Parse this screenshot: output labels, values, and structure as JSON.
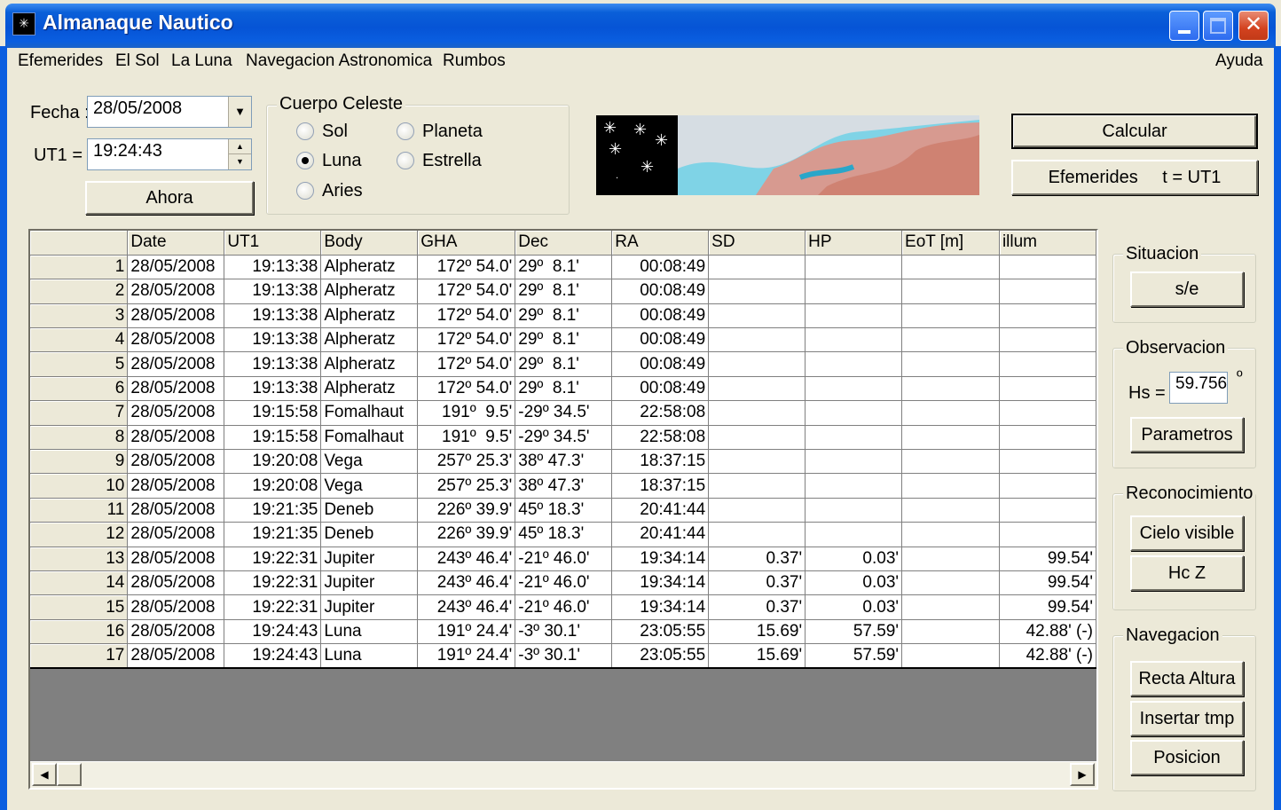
{
  "window": {
    "title": "Almanaque Nautico",
    "icon": "stars-icon"
  },
  "menu": {
    "efemerides": "Efemerides",
    "el_sol": "El Sol",
    "la_luna": "La Luna",
    "navegacion": "Navegacion Astronomica",
    "rumbos": "Rumbos",
    "ayuda": "Ayuda"
  },
  "fecha": {
    "label": "Fecha :",
    "value": "28/05/2008"
  },
  "ut1": {
    "label": "UT1 =",
    "value": "19:24:43"
  },
  "ahora_button": "Ahora",
  "cuerpo_celeste": {
    "title": "Cuerpo Celeste",
    "options": [
      "Sol",
      "Planeta",
      "Luna",
      "Estrella",
      "Aries"
    ],
    "selected": "Luna"
  },
  "calcular_button": "Calcular",
  "efemerides_button": "Efemerides",
  "efemerides_button_suffix": "t = UT1",
  "grid": {
    "columns": [
      "",
      "Date",
      "UT1",
      "Body",
      "GHA",
      "Dec",
      "RA",
      "SD",
      "HP",
      "EoT [m]",
      "illum"
    ],
    "rows": [
      [
        "1",
        "28/05/2008",
        "19:13:38",
        "Alpheratz",
        "172º 54.0'",
        "29º  8.1'",
        "00:08:49",
        "",
        "",
        "",
        ""
      ],
      [
        "2",
        "28/05/2008",
        "19:13:38",
        "Alpheratz",
        "172º 54.0'",
        "29º  8.1'",
        "00:08:49",
        "",
        "",
        "",
        ""
      ],
      [
        "3",
        "28/05/2008",
        "19:13:38",
        "Alpheratz",
        "172º 54.0'",
        "29º  8.1'",
        "00:08:49",
        "",
        "",
        "",
        ""
      ],
      [
        "4",
        "28/05/2008",
        "19:13:38",
        "Alpheratz",
        "172º 54.0'",
        "29º  8.1'",
        "00:08:49",
        "",
        "",
        "",
        ""
      ],
      [
        "5",
        "28/05/2008",
        "19:13:38",
        "Alpheratz",
        "172º 54.0'",
        "29º  8.1'",
        "00:08:49",
        "",
        "",
        "",
        ""
      ],
      [
        "6",
        "28/05/2008",
        "19:13:38",
        "Alpheratz",
        "172º 54.0'",
        "29º  8.1'",
        "00:08:49",
        "",
        "",
        "",
        ""
      ],
      [
        "7",
        "28/05/2008",
        "19:15:58",
        "Fomalhaut",
        "191º  9.5'",
        "-29º 34.5'",
        "22:58:08",
        "",
        "",
        "",
        ""
      ],
      [
        "8",
        "28/05/2008",
        "19:15:58",
        "Fomalhaut",
        "191º  9.5'",
        "-29º 34.5'",
        "22:58:08",
        "",
        "",
        "",
        ""
      ],
      [
        "9",
        "28/05/2008",
        "19:20:08",
        "Vega",
        "257º 25.3'",
        "38º 47.3'",
        "18:37:15",
        "",
        "",
        "",
        ""
      ],
      [
        "10",
        "28/05/2008",
        "19:20:08",
        "Vega",
        "257º 25.3'",
        "38º 47.3'",
        "18:37:15",
        "",
        "",
        "",
        ""
      ],
      [
        "11",
        "28/05/2008",
        "19:21:35",
        "Deneb",
        "226º 39.9'",
        "45º 18.3'",
        "20:41:44",
        "",
        "",
        "",
        ""
      ],
      [
        "12",
        "28/05/2008",
        "19:21:35",
        "Deneb",
        "226º 39.9'",
        "45º 18.3'",
        "20:41:44",
        "",
        "",
        "",
        ""
      ],
      [
        "13",
        "28/05/2008",
        "19:22:31",
        "Jupiter",
        "243º 46.4'",
        "-21º 46.0'",
        "19:34:14",
        "0.37'",
        "0.03'",
        "",
        "99.54'"
      ],
      [
        "14",
        "28/05/2008",
        "19:22:31",
        "Jupiter",
        "243º 46.4'",
        "-21º 46.0'",
        "19:34:14",
        "0.37'",
        "0.03'",
        "",
        "99.54'"
      ],
      [
        "15",
        "28/05/2008",
        "19:22:31",
        "Jupiter",
        "243º 46.4'",
        "-21º 46.0'",
        "19:34:14",
        "0.37'",
        "0.03'",
        "",
        "99.54'"
      ],
      [
        "16",
        "28/05/2008",
        "19:24:43",
        "Luna",
        "191º 24.4'",
        "-3º 30.1'",
        "23:05:55",
        "15.69'",
        "57.59'",
        "",
        "42.88' (-)"
      ],
      [
        "17",
        "28/05/2008",
        "19:24:43",
        "Luna",
        "191º 24.4'",
        "-3º 30.1'",
        "23:05:55",
        "15.69'",
        "57.59'",
        "",
        "42.88' (-)"
      ]
    ]
  },
  "situacion": {
    "title": "Situacion",
    "button": "s/e"
  },
  "observacion": {
    "title": "Observacion",
    "hs_label": "Hs =",
    "hs_value": "59.756",
    "hs_unit": "º",
    "button": "Parametros"
  },
  "reconocimiento": {
    "title": "Reconocimiento",
    "cielo_button": "Cielo visible",
    "hcz_button": "Hc Z"
  },
  "navegacion": {
    "title": "Navegacion",
    "recta_button": "Recta Altura",
    "insertar_button": "Insertar tmp",
    "posicion_button": "Posicion"
  }
}
